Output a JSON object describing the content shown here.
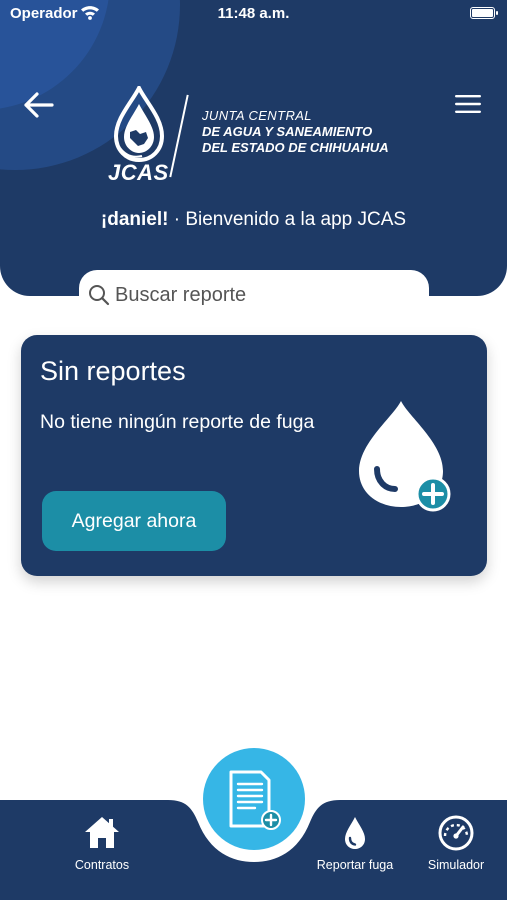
{
  "status_bar": {
    "carrier": "Operador",
    "time": "11:48 a.m."
  },
  "header": {
    "logo": {
      "abbr": "JCAS",
      "line1": "JUNTA CENTRAL",
      "line2": "DE AGUA Y SANEAMIENTO",
      "line3": "DEL ESTADO DE CHIHUAHUA"
    },
    "welcome_name": "¡daniel!",
    "welcome_text": " · Bienvenido a la app JCAS",
    "back_icon": "back-arrow-icon",
    "menu_icon": "hamburger-menu-icon"
  },
  "search": {
    "placeholder": "Buscar reporte",
    "icon": "search-icon"
  },
  "card": {
    "title": "Sin reportes",
    "message": "No tiene ningún reporte de fuga",
    "button_label": "Agregar ahora",
    "icon": "water-drop-add-icon"
  },
  "bottom_nav": {
    "items": [
      {
        "label": "Contratos",
        "icon": "home-icon"
      },
      {
        "label": "Reportar fuga",
        "icon": "water-drop-icon"
      },
      {
        "label": "Simulador",
        "icon": "speedometer-icon"
      }
    ],
    "fab_icon": "document-add-icon"
  },
  "colors": {
    "primary": "#1e3a66",
    "accent_teal": "#1c8ea6",
    "fab": "#36b6e6",
    "background": "#ffffff"
  }
}
